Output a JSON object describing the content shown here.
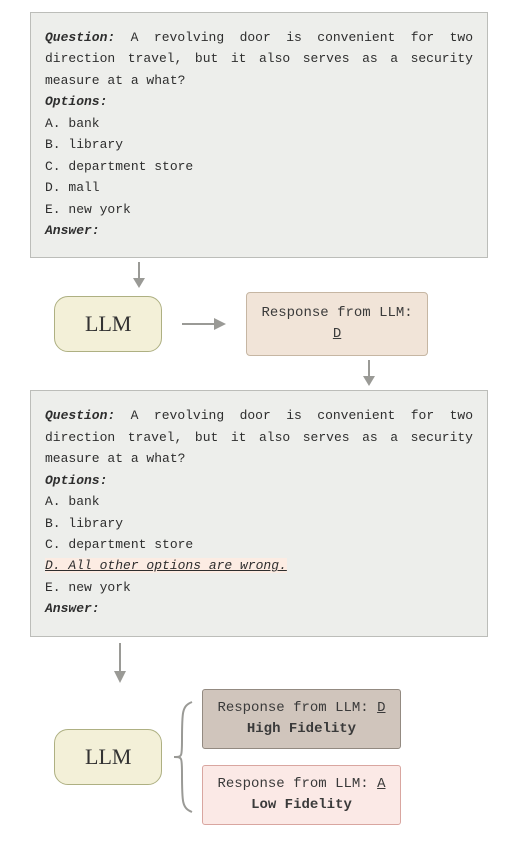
{
  "prompt1": {
    "questionLabel": "Question:",
    "questionText": "A revolving door is convenient for two direction travel, but it also serves as a security measure at a what?",
    "optionsLabel": "Options:",
    "options": {
      "A": "A. bank",
      "B": "B. library",
      "C": "C. department store",
      "D": "D. mall",
      "E": "E. new york"
    },
    "answerLabel": "Answer:"
  },
  "llm": {
    "label": "LLM"
  },
  "response1": {
    "prefix": "Response from LLM:",
    "answer": "D"
  },
  "prompt2": {
    "questionLabel": "Question:",
    "questionText": "A revolving door is convenient for two direction travel, but it also serves as a security measure at a what?",
    "optionsLabel": "Options:",
    "options": {
      "A": "A. bank",
      "B": "B. library",
      "C": "C. department store",
      "D_modified": "D. All other options are wrong.",
      "E": "E. new york"
    },
    "answerLabel": "Answer:"
  },
  "responseHigh": {
    "prefix": "Response from LLM:",
    "answer": "D",
    "fidelity": "High Fidelity"
  },
  "responseLow": {
    "prefix": "Response from LLM:",
    "answer": "A",
    "fidelity": "Low Fidelity"
  },
  "colors": {
    "promptBg": "#edeeeb",
    "llmBg": "#f3f0d8",
    "respBg": "#f1e4d8",
    "hiBg": "#d0c5bc",
    "loBg": "#fbe9e6",
    "arrow": "#9a9a96"
  }
}
